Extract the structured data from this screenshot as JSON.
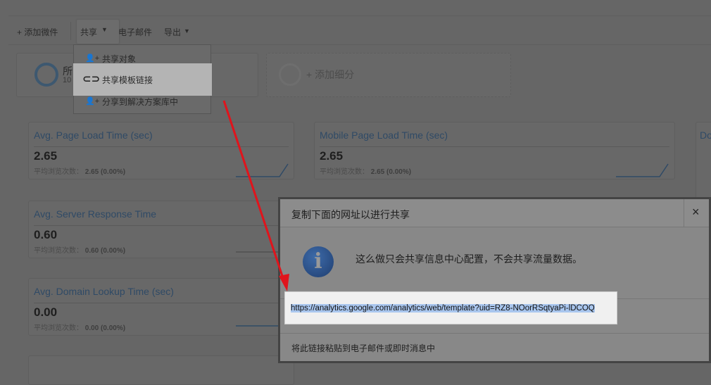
{
  "toolbar": {
    "add_widget": "+ 添加微件",
    "share": "共享",
    "email": "电子邮件",
    "export": "导出"
  },
  "segments": {
    "all_label": "所",
    "all_count": "10",
    "add_segment": "+ 添加细分"
  },
  "share_menu": {
    "items": [
      {
        "label": "共享对象",
        "icon": "add-person-icon"
      },
      {
        "label": "共享模板链接",
        "icon": "link-icon"
      },
      {
        "label": "分享到解决方案库中",
        "icon": "add-person-icon"
      }
    ]
  },
  "widgets": [
    {
      "title": "Avg. Page Load Time (sec)",
      "value": "2.65",
      "sub_label": "平均浏览次数：",
      "sub_value": "2.65 (0.00%)"
    },
    {
      "title": "Mobile Page Load Time (sec)",
      "value": "2.65",
      "sub_label": "平均浏览次数：",
      "sub_value": "2.65 (0.00%)"
    },
    {
      "title": "Avg. Server Response Time",
      "value": "0.60",
      "sub_label": "平均浏览次数：",
      "sub_value": "0.60 (0.00%)"
    },
    {
      "title": "Avg. Domain Lookup Time (sec)",
      "value": "0.00",
      "sub_label": "平均浏览次数：",
      "sub_value": "0.00 (0.00%)"
    },
    {
      "title": "Do"
    }
  ],
  "dialog": {
    "title": "复制下面的网址以进行共享",
    "close": "×",
    "info": "这么做只会共享信息中心配置，不会共享流量数据。",
    "url": "https://analytics.google.com/analytics/web/template?uid=RZ8-NOorRSqtyaPi-lDCOQ",
    "footer": "将此链接粘贴到电子邮件或即时消息中"
  },
  "colors": {
    "arrow": "#e0141c",
    "selection": "#a9c6ee"
  }
}
